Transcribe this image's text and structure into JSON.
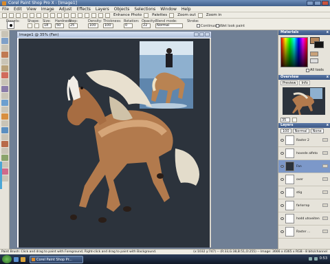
{
  "window": {
    "title": "Corel Paint Shop Pro X - [Image1]"
  },
  "menu": [
    "File",
    "Edit",
    "View",
    "Image",
    "Adjust",
    "Effects",
    "Layers",
    "Objects",
    "Selections",
    "Window",
    "Help"
  ],
  "toolbar": {
    "enhance_photo": "Enhance Photo",
    "palettes": "Palettes",
    "zoom_out": "Zoom out",
    "zoom_in": "Zoom in"
  },
  "options": {
    "presets_label": "Presets:",
    "shape_label": "Shape:",
    "size_label": "Size:",
    "size_value": "18",
    "hardness_label": "Hardness:",
    "hardness_value": "50",
    "step_label": "Step:",
    "step_value": "25",
    "density_label": "Density:",
    "density_value": "100",
    "thickness_label": "Thickness:",
    "thickness_value": "100",
    "rotation_label": "Rotation:",
    "rotation_value": "0",
    "opacity_label": "Opacity:",
    "opacity_value": "22",
    "blend_label": "Blend mode:",
    "blend_value": "Normal",
    "stroke_label": "Stroke:",
    "continuous_label": "Continuous",
    "wet_look_label": "Wet look paint"
  },
  "image_window": {
    "title": "Image1 @ 35% (Fan)"
  },
  "palettes": {
    "materials_title": "Materials",
    "all_tools": "All tools",
    "overview_title": "Overview",
    "preview_tab": "Preview",
    "info_tab": "Info",
    "zoom_value": "35",
    "layers_title": "Layers",
    "layer_blend": "Normal",
    "layer_opacity": "100",
    "layer_none": "None"
  },
  "layers": [
    {
      "name": "Raster 2"
    },
    {
      "name": "hovede alfeto"
    },
    {
      "name": "Fan"
    },
    {
      "name": "over"
    },
    {
      "name": "stig"
    },
    {
      "name": "farlorrop"
    },
    {
      "name": "hodd utsveiten"
    },
    {
      "name": "Raster ..."
    }
  ],
  "status": {
    "hint": "Paint Brush: Click and drag to paint with Foreground; Right-click and drag to paint with Background.",
    "info": "(x:1032 y:747) -- (R:33,G:38,B:51,O:255) -- Image: 3666 x 4365 x RGB - 8 bits/channel"
  },
  "taskbar": {
    "task": "Corel Paint Shop Pr...",
    "clock": "0:53"
  }
}
